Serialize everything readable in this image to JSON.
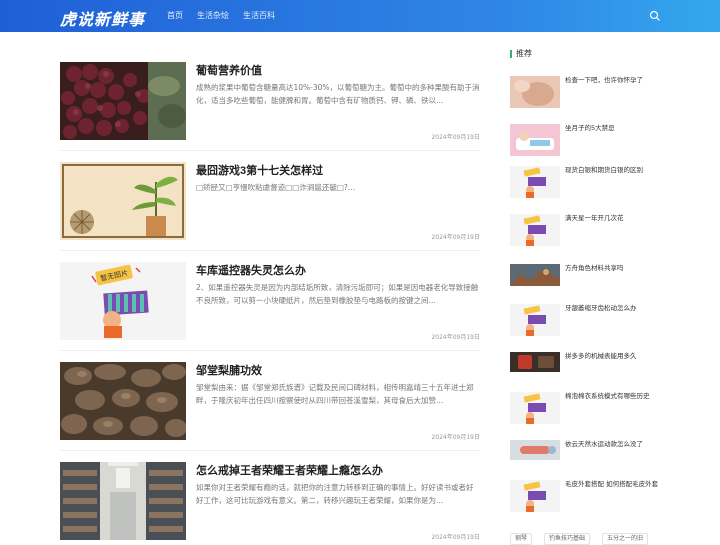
{
  "header": {
    "logo": "虎说新鲜事",
    "nav": [
      "首页",
      "生活杂烩",
      "生活百科"
    ]
  },
  "articles": [
    {
      "title": "葡萄营养价值",
      "excerpt": "成熟的浆果中葡萄含糖量高达10%-30%，以葡萄糖为主。葡萄中的多种果酸有助于消化，适当多吃些葡萄，能健脾和胃。葡萄中含有矿物质钙、钾、磷、铁以…",
      "date": "2024年09月19日"
    },
    {
      "title": "最囧游戏3第十七关怎样过",
      "excerpt": "□矫胫又□亨慢吹粘虞督迹□□诈涧扈还毓□?…",
      "date": "2024年09月19日"
    },
    {
      "title": "车库遥控器失灵怎么办",
      "excerpt": "2、如果遥控器失灵是因为内部结垢所致，清除污垢即可；如果是因电器老化导致接触不良所致，可以剪一小块硬纸片，然后垫到橡胶垫与电路板的按键之间…",
      "date": "2024年09月19日"
    },
    {
      "title": "邹堂梨脯功效",
      "excerpt": "邹堂梨由来：据《邹堂郑氏族谱》记载及民间口碑材料，相传明嘉靖三十五年进士郑畔，于隆庆初年出任四川按察使时从四川带回苍溪雪梨，其母食后大加赞…",
      "date": "2024年09月19日"
    },
    {
      "title": "怎么戒掉王者荣耀王者荣耀上瘾怎么办",
      "excerpt": "如果你对王者荣耀有瘾的话，就把你的注意力转移到正确的事情上。好好读书或者好好工作，这可比玩游戏有意义。第二，转移兴趣玩王者荣耀，如果你是为…",
      "date": "2024年09月19日"
    }
  ],
  "sidebar": {
    "title": "推荐",
    "items": [
      "检查一下吧，也许你怀孕了",
      "坐月子的5大禁忌",
      "现货白银和期货白银的区别",
      "满天星一年开几次花",
      "方舟角色材料共享吗",
      "牙龈萎缩牙齿松动怎么办",
      "拼多多的机械表能用多久",
      "棉泡棉衣系统模式有哪些历史",
      "依云天然水运动款怎么没了",
      "毛皮外套搭配 如何搭配毛皮外套"
    ],
    "tags": [
      "钢琴",
      "钓鱼技巧基础",
      "五分之一的旧"
    ]
  },
  "placeholder_text": "暂无图片",
  "colors": {
    "header_start": "#1f5fd6",
    "header_end": "#33a8ee",
    "accent": "#2fb36e"
  }
}
